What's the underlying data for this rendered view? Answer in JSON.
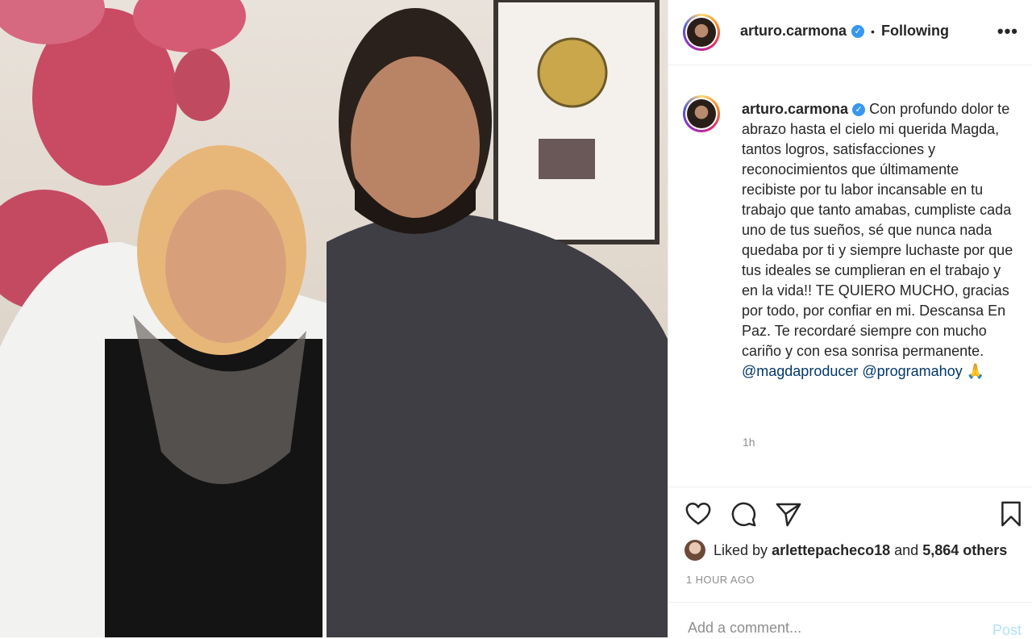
{
  "post": {
    "username": "arturo.carmona",
    "follow_separator": "•",
    "follow_label": "Following",
    "more_label": "•••",
    "caption_text": "Con profundo dolor te abrazo hasta el cielo mi querida Magda, tantos logros, satisfacciones y reconocimientos que últimamente recibiste por tu labor incansable en tu trabajo que tanto amabas, cumpliste cada uno de tus sueños, sé que nunca nada quedaba por ti y siempre luchaste por que tus ideales se cumplieran en el trabajo y en la vida!! TE QUIERO MUCHO, gracias por todo, por confiar en mi. Descansa En Paz. Te recordaré siempre con mucho cariño y con esa sonrisa permanente.",
    "mentions": [
      "@magdaproducer",
      "@programahoy"
    ],
    "emoji": "🙏",
    "relative_time": "1h"
  },
  "likes": {
    "prefix": "Liked by",
    "liker": "arlettepacheco18",
    "joiner": "and",
    "others": "5,864 others"
  },
  "timestamp": "1 HOUR AGO",
  "comment_box": {
    "placeholder": "Add a comment...",
    "post_label": "Post"
  },
  "colors": {
    "verified": "#3897f0",
    "mention": "#00376b",
    "post_disabled": "#b2dffc",
    "muted": "#8e8e8e"
  },
  "icons": [
    "heart-icon",
    "comment-icon",
    "share-icon",
    "bookmark-icon",
    "verified-badge-icon",
    "more-options-icon"
  ]
}
